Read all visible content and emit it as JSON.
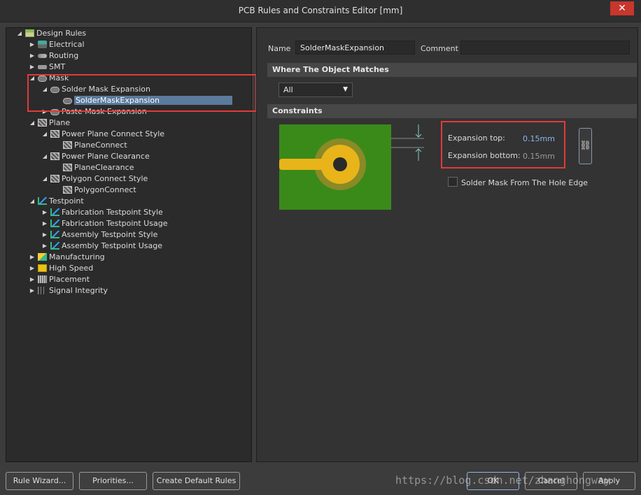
{
  "window": {
    "title": "PCB Rules and Constraints Editor [mm]",
    "close_glyph": "✕"
  },
  "tree": {
    "root": "Design Rules",
    "electrical": "Electrical",
    "routing": "Routing",
    "smt": "SMT",
    "mask": "Mask",
    "solder_mask_expansion": "Solder Mask Expansion",
    "solder_mask_rule": "SolderMaskExpansion",
    "paste_mask_expansion": "Paste Mask Expansion",
    "plane": "Plane",
    "power_plane_connect_style": "Power Plane Connect Style",
    "plane_connect": "PlaneConnect",
    "power_plane_clearance": "Power Plane Clearance",
    "plane_clearance": "PlaneClearance",
    "polygon_connect_style": "Polygon Connect Style",
    "polygon_connect": "PolygonConnect",
    "testpoint": "Testpoint",
    "fab_testpoint_style": "Fabrication Testpoint Style",
    "fab_testpoint_usage": "Fabrication Testpoint Usage",
    "asm_testpoint_style": "Assembly Testpoint Style",
    "asm_testpoint_usage": "Assembly Testpoint Usage",
    "manufacturing": "Manufacturing",
    "high_speed": "High Speed",
    "placement": "Placement",
    "signal_integrity": "Signal Integrity"
  },
  "rule": {
    "name_label": "Name",
    "name_value": "SolderMaskExpansion",
    "comment_label": "Comment",
    "comment_value": ""
  },
  "where_matches": {
    "header": "Where The Object Matches",
    "selected": "All"
  },
  "constraints": {
    "header": "Constraints",
    "expansion_top_label": "Expansion top:",
    "expansion_top_value": "0.15mm",
    "expansion_bottom_label": "Expansion bottom:",
    "expansion_bottom_value": "0.15mm",
    "hole_edge_label": "Solder Mask From The Hole Edge",
    "hole_edge_checked": false
  },
  "buttons": {
    "rule_wizard": "Rule Wizard...",
    "priorities": "Priorities...",
    "create_default_rules": "Create Default Rules",
    "ok": "OK",
    "cancel": "Cancel",
    "apply": "Apply"
  },
  "watermark": "https://blog.csdn.net/zhanghongway",
  "colors": {
    "accent": "#5b7a9c",
    "highlight": "#e23a3a",
    "pcb_green": "#3a8a1a",
    "pad_gold": "#e8b41a"
  }
}
